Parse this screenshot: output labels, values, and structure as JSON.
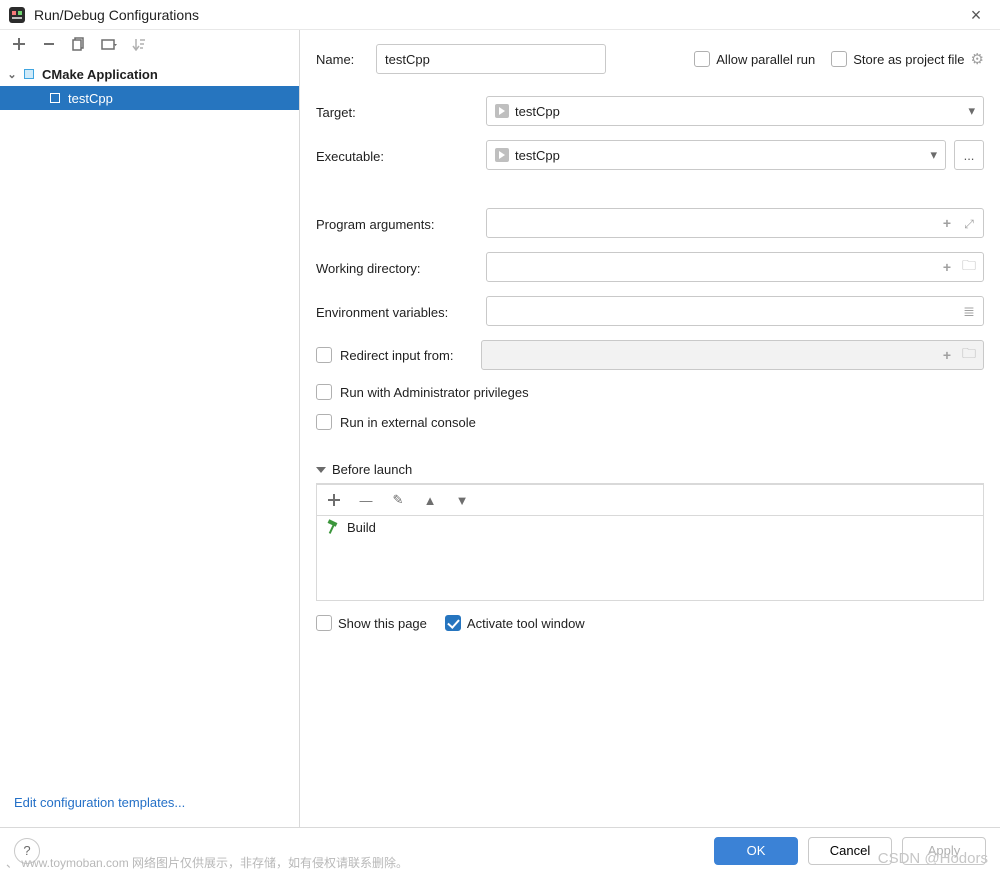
{
  "window": {
    "title": "Run/Debug Configurations"
  },
  "sidebar": {
    "category_label": "CMake Application",
    "items": [
      {
        "label": "testCpp"
      }
    ],
    "edit_templates": "Edit configuration templates..."
  },
  "form": {
    "name_label": "Name:",
    "name_value": "testCpp",
    "allow_parallel": "Allow parallel run",
    "store_as_project": "Store as project file",
    "target_label": "Target:",
    "target_value": "testCpp",
    "executable_label": "Executable:",
    "executable_value": "testCpp",
    "browse_btn": "...",
    "program_args_label": "Program arguments:",
    "working_dir_label": "Working directory:",
    "env_vars_label": "Environment variables:",
    "redirect_label": "Redirect input from:",
    "run_admin": "Run with Administrator privileges",
    "run_external": "Run in external console"
  },
  "before_launch": {
    "section_title": "Before launch",
    "items": [
      {
        "label": "Build"
      }
    ],
    "show_this_page": "Show this page",
    "activate_tool_window": "Activate tool window"
  },
  "footer": {
    "ok": "OK",
    "cancel": "Cancel",
    "apply": "Apply"
  },
  "watermark": {
    "left": "、 www.toymoban.com 网络图片仅供展示，非存储，如有侵权请联系删除。",
    "right": "CSDN @Hodors"
  }
}
